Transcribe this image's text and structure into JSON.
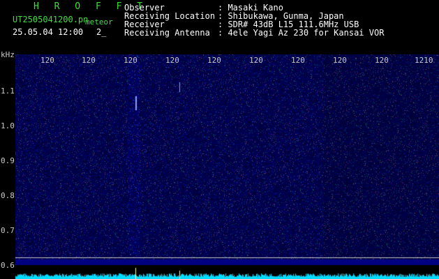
{
  "app": {
    "name": "H R O F F T",
    "filename": "UT2505041200.pn",
    "mode": "meteor",
    "datetime": "25.05.04 12:00",
    "count": "2_"
  },
  "info": {
    "rows": [
      {
        "label": "Observer",
        "value": ": Masaki Kano"
      },
      {
        "label": "Receiving Location",
        "value": ": Shibukawa, Gunma, Japan"
      },
      {
        "label": "Receiver",
        "value": ": SDR# 43dB L15 111.6MHz USB"
      },
      {
        "label": "Receiving Antenna",
        "value": ": 4ele Yagi Az 230 for Kansai VOR"
      }
    ]
  },
  "axes": {
    "y_unit": "kHz",
    "x_ticks": [
      "120",
      "120",
      "120",
      "120",
      "120",
      "120",
      "120",
      "120",
      "120",
      "1210"
    ],
    "y_ticks": [
      "1.1",
      "1.0",
      "0.9",
      "0.8",
      "0.7",
      "0.6"
    ]
  },
  "colors": {
    "background": "#000000",
    "spectrogram_base": "#00004a",
    "noise_dot": "#3a3aff",
    "tick_line": "#ffffff",
    "waveform": "#00dcff"
  }
}
